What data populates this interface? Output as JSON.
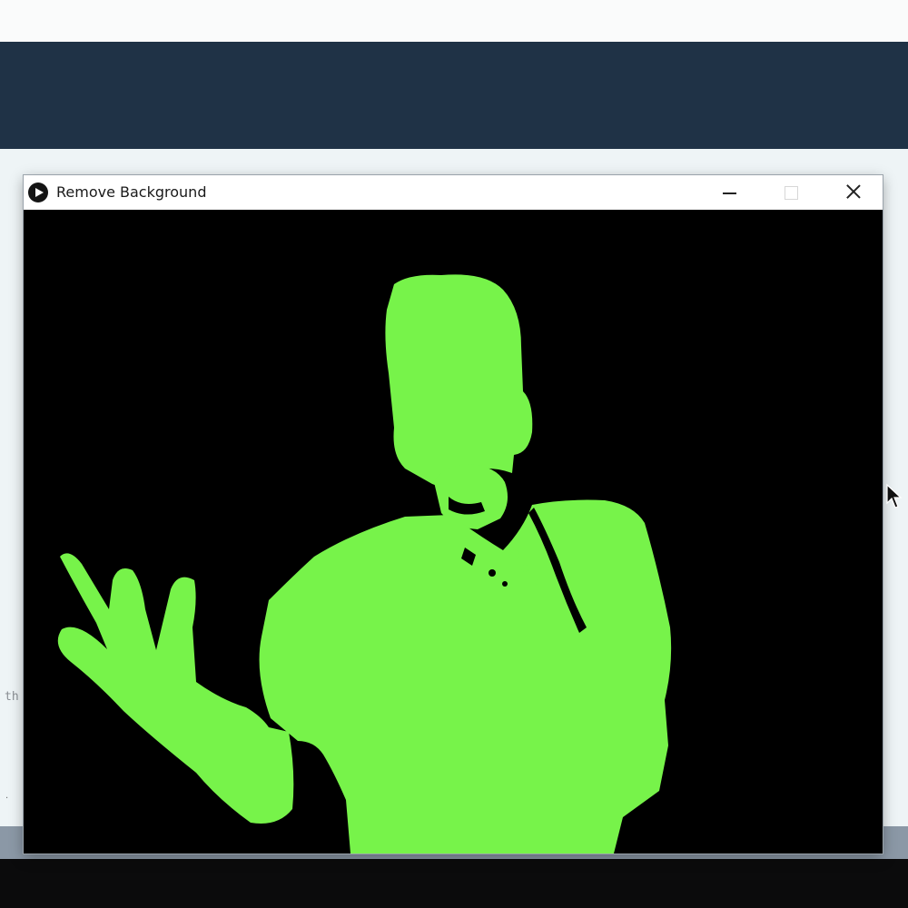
{
  "window": {
    "title": "Remove Background",
    "icon": "play-circle-icon",
    "controls": {
      "minimize": "minimize-icon",
      "maximize": "maximize-icon",
      "close": "close-icon"
    }
  },
  "canvas": {
    "background_color": "#000000",
    "silhouette_color": "#77f34a"
  },
  "editor": {
    "snippet": "th"
  },
  "colors": {
    "header_band": "#1f3246",
    "status_bar": "#8b98a6",
    "console": "#0b0b0c"
  },
  "cursor": "arrow-pointer-icon"
}
